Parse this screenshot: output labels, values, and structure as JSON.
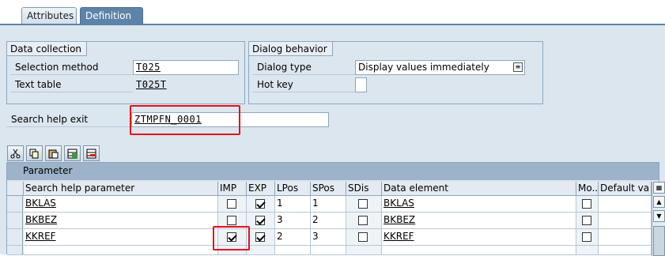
{
  "tabs": [
    {
      "label": "Attributes",
      "active": false
    },
    {
      "label": "Definition",
      "active": true
    }
  ],
  "data_collection": {
    "title": "Data collection",
    "selection_method_label": "Selection method",
    "selection_method_value": "T025",
    "text_table_label": "Text table",
    "text_table_value": "T025T"
  },
  "dialog_behavior": {
    "title": "Dialog behavior",
    "dialog_type_label": "Dialog type",
    "dialog_type_value": "Display values immediately",
    "hot_key_label": "Hot key",
    "hot_key_value": ""
  },
  "search_help_exit": {
    "label": "Search help exit",
    "value": "ZTMPFN_0001"
  },
  "toolbar": {
    "icons": [
      "cut-icon",
      "copy-icon",
      "paste-icon",
      "insert-row-icon",
      "delete-row-icon"
    ]
  },
  "table": {
    "title": "Parameter",
    "columns": [
      "Search help parameter",
      "IMP",
      "EXP",
      "LPos",
      "SPos",
      "SDis",
      "Data element",
      "Mo...",
      "Default va"
    ],
    "rows": [
      {
        "param": "BKLAS",
        "imp": false,
        "exp": true,
        "lpos": "1",
        "spos": "1",
        "sdis": false,
        "data_element": "BKLAS",
        "mod": false,
        "default": ""
      },
      {
        "param": "BKBEZ",
        "imp": false,
        "exp": true,
        "lpos": "3",
        "spos": "2",
        "sdis": false,
        "data_element": "BKBEZ",
        "mod": false,
        "default": ""
      },
      {
        "param": "KKREF",
        "imp": true,
        "exp": true,
        "lpos": "2",
        "spos": "3",
        "sdis": false,
        "data_element": "KKREF",
        "mod": false,
        "default": ""
      }
    ]
  },
  "colors": {
    "tab_active": "#5d83a8",
    "panel_bg": "#dce6ef",
    "highlight_box": "#e2141c"
  }
}
